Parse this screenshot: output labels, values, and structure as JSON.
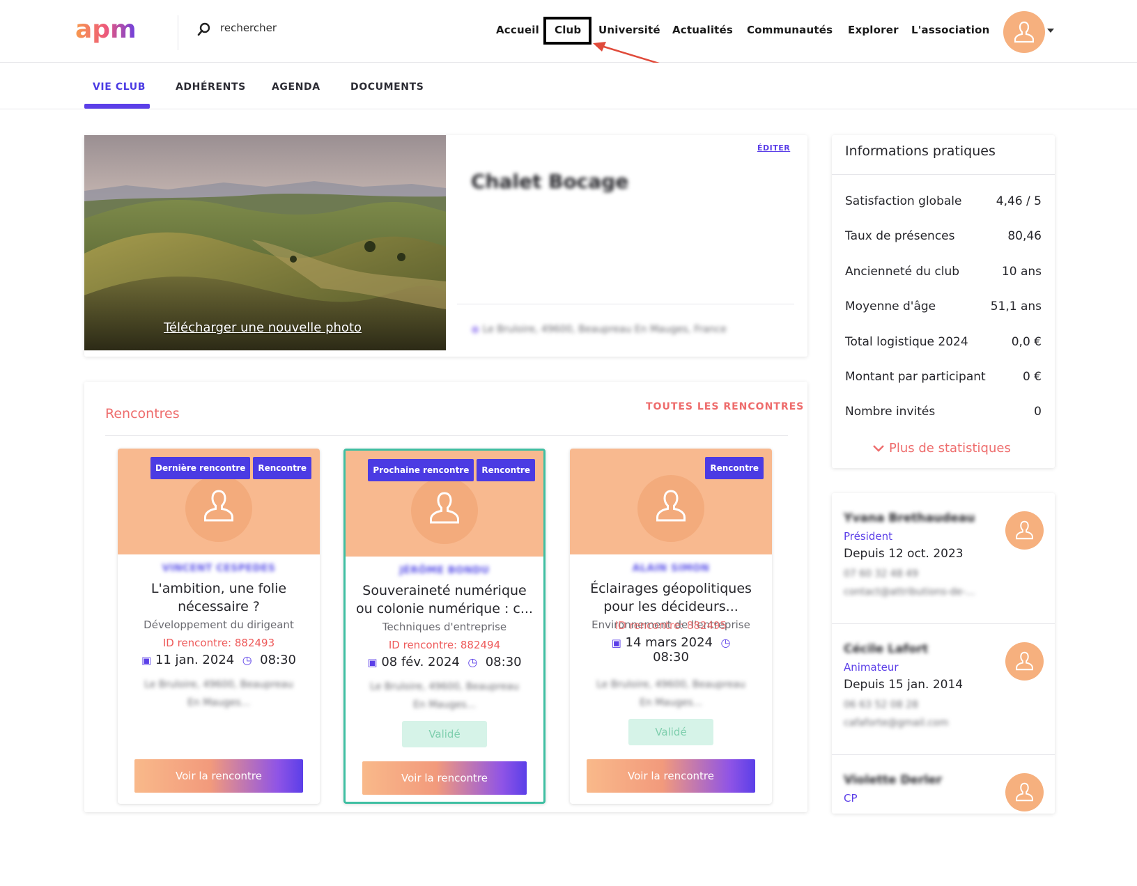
{
  "header": {
    "search_placeholder": "rechercher",
    "nav": [
      "Accueil",
      "Club",
      "Université",
      "Actualités",
      "Communautés",
      "Explorer",
      "L'association"
    ]
  },
  "subnav": {
    "tabs": [
      "VIE CLUB",
      "ADHÉRENTS",
      "AGENDA",
      "DOCUMENTS"
    ],
    "active": "VIE CLUB"
  },
  "club": {
    "name": "Chalet Bocage",
    "edit_label": "ÉDITER",
    "upload_label": "Télécharger une nouvelle photo",
    "address": "Le Bruloire, 49600, Beaupreau En Mauges, France"
  },
  "rencontres": {
    "title": "Rencontres",
    "all_link": "TOUTES LES RENCONTRES",
    "cards": [
      {
        "badges": [
          "Dernière rencontre",
          "Rencontre"
        ],
        "speaker": "VINCENT CESPEDES",
        "title": "L'ambition, une folie nécessaire ?",
        "category": "Développement du dirigeant",
        "id_label": "ID rencontre: 882493",
        "date": "11 jan. 2024",
        "time": "08:30",
        "address": "Le Bruloire, 49600, Beaupreau En Mauges...",
        "status": "",
        "button": "Voir la rencontre"
      },
      {
        "badges": [
          "Prochaine rencontre",
          "Rencontre"
        ],
        "speaker": "JÉRÔME BONDU",
        "title": "Souveraineté numérique ou colonie numérique : c...",
        "category": "Techniques d'entreprise",
        "id_label": "ID rencontre: 882494",
        "date": "08 fév. 2024",
        "time": "08:30",
        "address": "Le Bruloire, 49600, Beaupreau En Mauges...",
        "status": "Validé",
        "button": "Voir la rencontre"
      },
      {
        "badges": [
          "Rencontre"
        ],
        "speaker": "ALAIN SIMON",
        "title": "Éclairages géopolitiques pour les décideurs...",
        "category": "Environnement de l'entreprise",
        "id_label": "ID rencontre: 882495",
        "date": "14 mars 2024",
        "time": "08:30",
        "address": "Le Bruloire, 49600, Beaupreau En Mauges...",
        "status": "Validé",
        "button": "Voir la rencontre"
      }
    ]
  },
  "infos": {
    "title": "Informations pratiques",
    "stats": [
      {
        "label": "Satisfaction globale",
        "value": "4,46 / 5"
      },
      {
        "label": "Taux de présences",
        "value": "80,46"
      },
      {
        "label": "Ancienneté du club",
        "value": "10 ans"
      },
      {
        "label": "Moyenne d'âge",
        "value": "51,1 ans"
      },
      {
        "label": "Total logistique 2024",
        "value": "0,0 €"
      },
      {
        "label": "Montant par participant",
        "value": "0 €"
      },
      {
        "label": "Nombre invités",
        "value": "0"
      }
    ],
    "more": "Plus de statistiques"
  },
  "people": [
    {
      "name": "Yvana Brethaudeau",
      "role": "Président",
      "since": "Depuis 12 oct. 2023",
      "phone": "07 60 32 48 49",
      "email": "contact@attributions-de-..."
    },
    {
      "name": "Cécile Lafort",
      "role": "Animateur",
      "since": "Depuis 15 jan. 2014",
      "phone": "06 63 52 08 28",
      "email": "cafaforte@gmail.com"
    },
    {
      "name": "Violette Derler",
      "role": "CP",
      "since": "",
      "phone": "",
      "email": ""
    }
  ],
  "colors": {
    "accent": "#4b3be3",
    "coral": "#ee6c6c",
    "avatar": "#f6b07e",
    "selected": "#3fbfa2"
  }
}
